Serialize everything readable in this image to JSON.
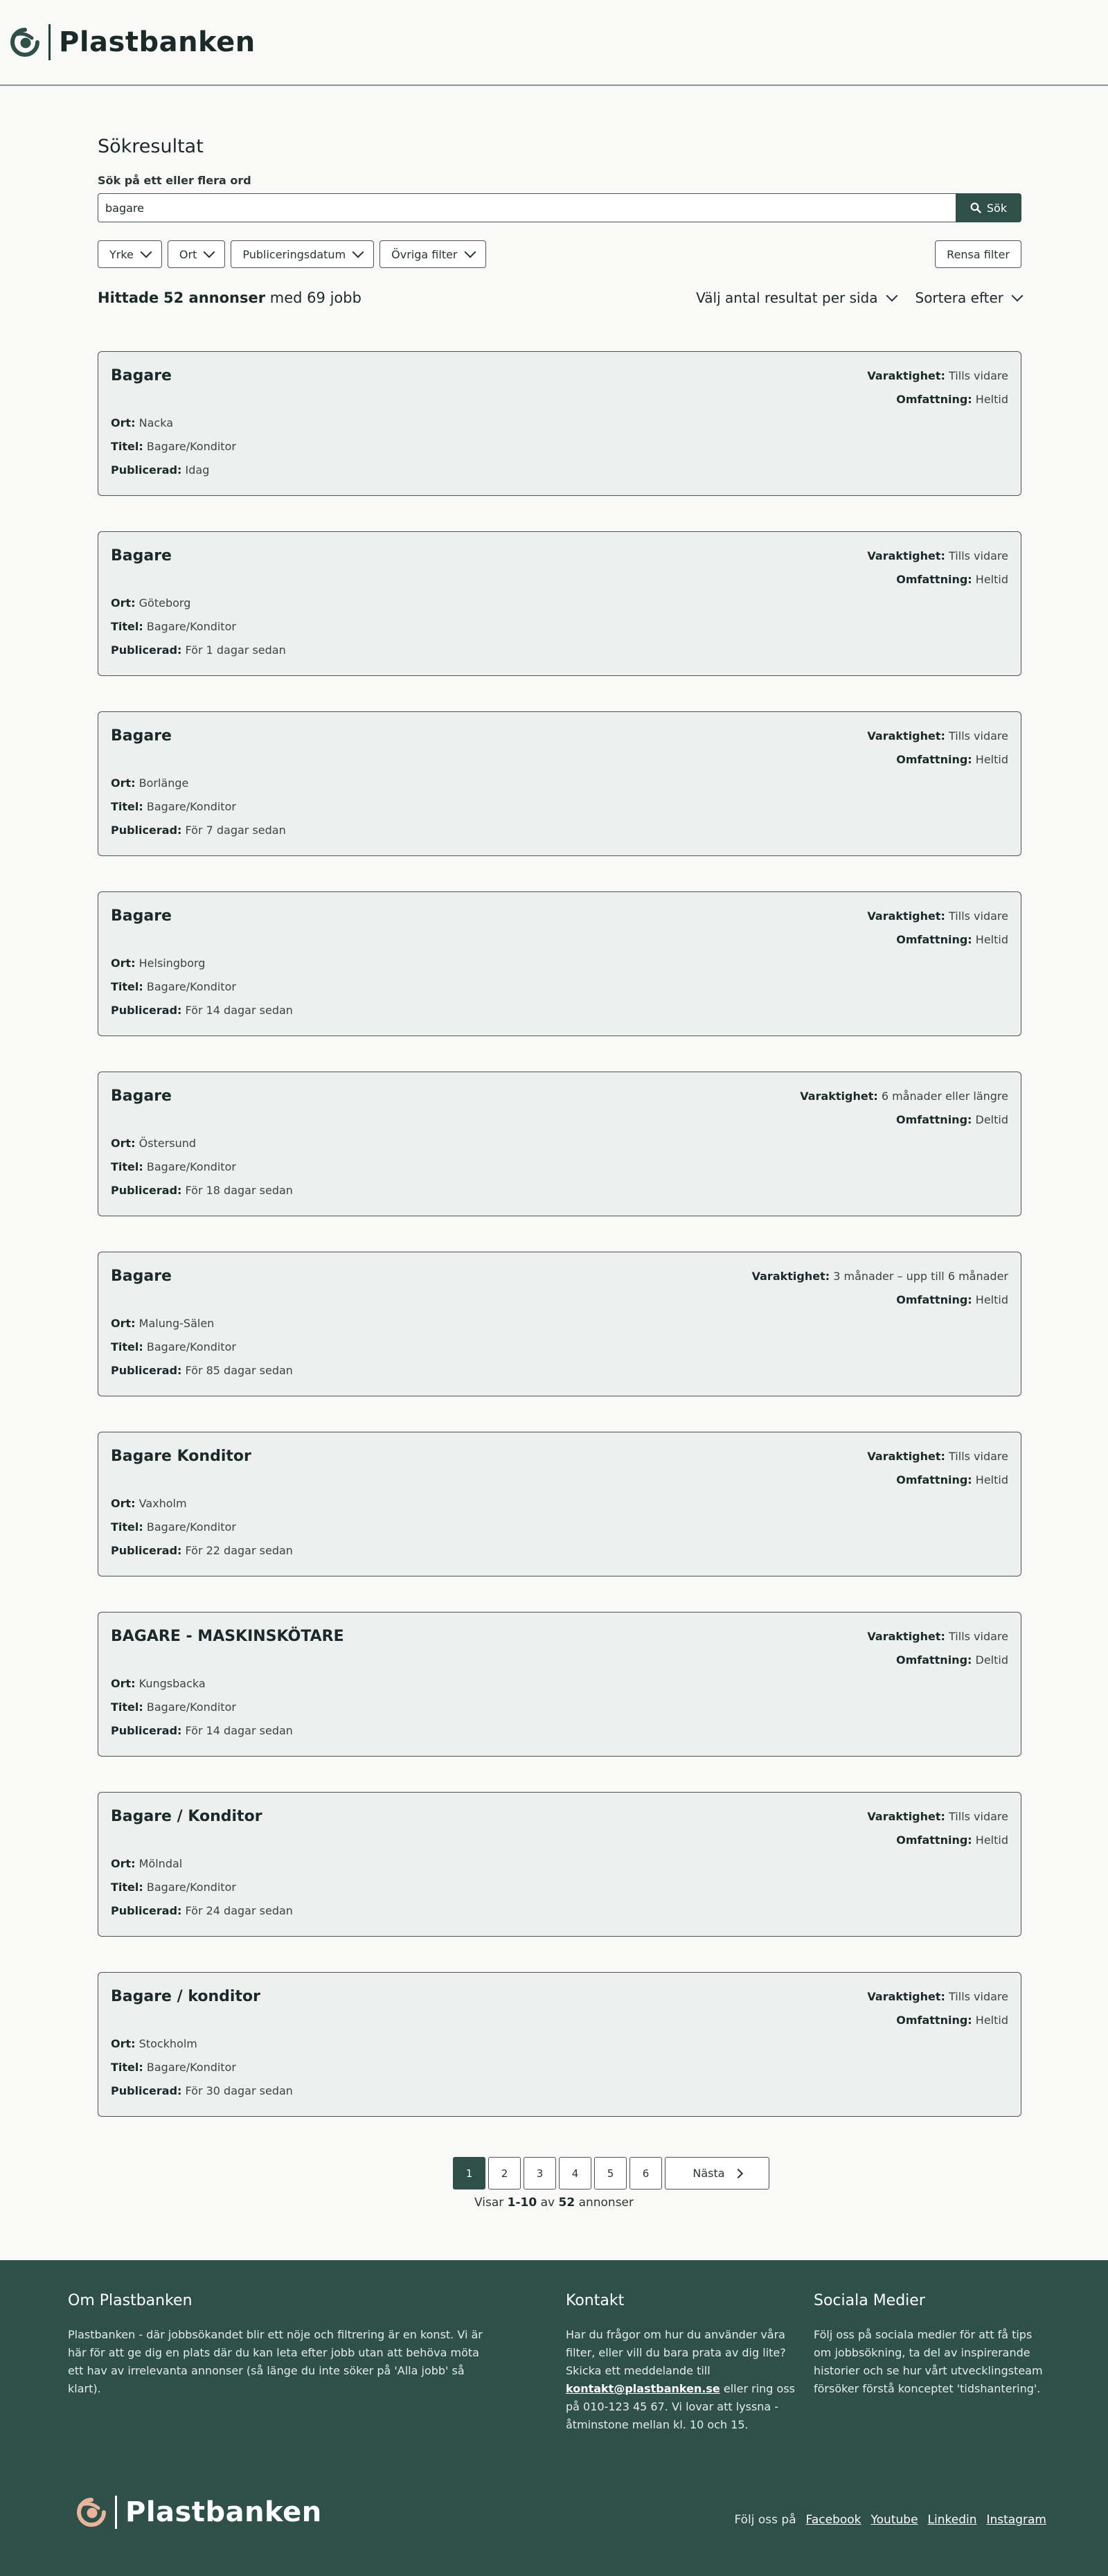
{
  "brand": {
    "name": "Plastbanken"
  },
  "search": {
    "title": "Sökresultat",
    "label": "Sök på ett eller flera ord",
    "value": "bagare",
    "button": "Sök"
  },
  "filters": {
    "items": [
      "Yrke",
      "Ort",
      "Publiceringsdatum",
      "Övriga filter"
    ],
    "clear": "Rensa filter"
  },
  "results": {
    "prefix": "Hittade",
    "ads_count": "52 annonser",
    "mid": "med",
    "jobs_count": "69 jobb",
    "per_page": "Välj antal resultat per sida",
    "sort": "Sortera efter"
  },
  "labels": {
    "duration": "Varaktighet:",
    "scope": "Omfattning:",
    "location": "Ort:",
    "title": "Titel:",
    "published": "Publicerad:"
  },
  "jobs": [
    {
      "heading": "Bagare",
      "duration": "Tills vidare",
      "scope": "Heltid",
      "location": "Nacka",
      "title": "Bagare/Konditor",
      "published": "Idag"
    },
    {
      "heading": "Bagare",
      "duration": "Tills vidare",
      "scope": "Heltid",
      "location": "Göteborg",
      "title": "Bagare/Konditor",
      "published": "För 1 dagar sedan"
    },
    {
      "heading": "Bagare",
      "duration": "Tills vidare",
      "scope": "Heltid",
      "location": "Borlänge",
      "title": "Bagare/Konditor",
      "published": "För 7 dagar sedan"
    },
    {
      "heading": "Bagare",
      "duration": "Tills vidare",
      "scope": "Heltid",
      "location": "Helsingborg",
      "title": "Bagare/Konditor",
      "published": "För 14 dagar sedan"
    },
    {
      "heading": "Bagare",
      "duration": "6 månader eller längre",
      "scope": "Deltid",
      "location": "Östersund",
      "title": "Bagare/Konditor",
      "published": "För 18 dagar sedan"
    },
    {
      "heading": "Bagare",
      "duration": "3 månader – upp till 6 månader",
      "scope": "Heltid",
      "location": "Malung-Sälen",
      "title": "Bagare/Konditor",
      "published": "För 85 dagar sedan"
    },
    {
      "heading": "Bagare Konditor",
      "duration": "Tills vidare",
      "scope": "Heltid",
      "location": "Vaxholm",
      "title": "Bagare/Konditor",
      "published": "För 22 dagar sedan"
    },
    {
      "heading": "BAGARE - MASKINSKÖTARE",
      "duration": "Tills vidare",
      "scope": "Deltid",
      "location": "Kungsbacka",
      "title": "Bagare/Konditor",
      "published": "För 14 dagar sedan"
    },
    {
      "heading": "Bagare / Konditor",
      "duration": "Tills vidare",
      "scope": "Heltid",
      "location": "Mölndal",
      "title": "Bagare/Konditor",
      "published": "För 24 dagar sedan"
    },
    {
      "heading": "Bagare / konditor",
      "duration": "Tills vidare",
      "scope": "Heltid",
      "location": "Stockholm",
      "title": "Bagare/Konditor",
      "published": "För 30 dagar sedan"
    }
  ],
  "pagination": {
    "pages": [
      "1",
      "2",
      "3",
      "4",
      "5",
      "6"
    ],
    "current": "1",
    "next": "Nästa",
    "showing_prefix": "Visar",
    "showing_range": "1-10",
    "showing_mid": "av",
    "showing_total": "52",
    "showing_suffix": "annonser"
  },
  "footer": {
    "about_title": "Om Plastbanken",
    "about_text": "Plastbanken - där jobbsökandet blir ett nöje och filtrering är en konst. Vi är här för att ge dig en plats där du kan leta efter jobb utan att behöva möta ett hav av irrelevanta annonser (så länge du inte söker på 'Alla jobb' så klart).",
    "contact_title": "Kontakt",
    "contact_text": "Har du frågor om hur du använder våra filter, eller vill du bara prata av dig lite? Skicka ett meddelande till",
    "contact_email": "kontakt@plastbanken.se",
    "contact_text2": "eller ring oss på 010-123 45 67. Vi lovar att lyssna - åtminstone mellan kl. 10 och 15.",
    "social_title": "Sociala Medier",
    "social_text": "Följ oss på sociala medier för att få tips om jobbsökning, ta del av inspirerande historier och se hur vårt utvecklingsteam försöker förstå konceptet 'tidshantering'.",
    "follow_label": "Följ oss på",
    "social_links": [
      "Facebook",
      "Youtube",
      "Linkedin",
      "Instagram"
    ]
  },
  "colors": {
    "primary": "#2e5049",
    "card_bg": "#edf0ef",
    "accent_logo_footer": "#e8b59a"
  }
}
